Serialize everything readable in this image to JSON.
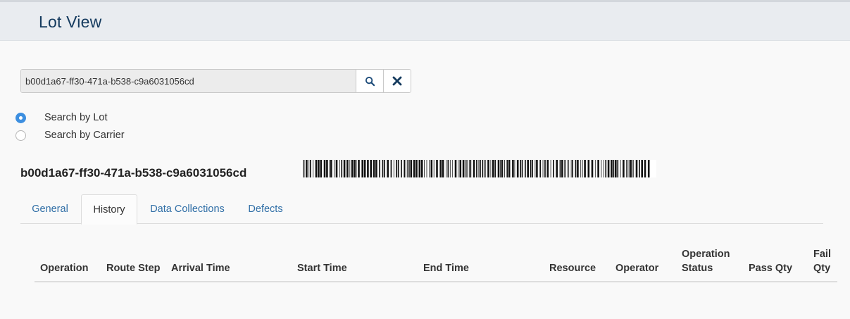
{
  "header": {
    "title": "Lot View"
  },
  "search": {
    "value": "b00d1a67-ff30-471a-b538-c9a6031056cd"
  },
  "search_mode": [
    {
      "label": "Search by Lot",
      "checked": true
    },
    {
      "label": "Search by Carrier",
      "checked": false
    }
  ],
  "lot": {
    "id": "b00d1a67-ff30-471a-b538-c9a6031056cd"
  },
  "tabs": [
    {
      "label": "General",
      "active": false
    },
    {
      "label": "History",
      "active": true
    },
    {
      "label": "Data Collections",
      "active": false
    },
    {
      "label": "Defects",
      "active": false
    }
  ],
  "history_table": {
    "columns": [
      "Operation",
      "Route Step",
      "Arrival Time",
      "Start Time",
      "End Time",
      "Resource",
      "Operator",
      "Operation Status",
      "Pass Qty",
      "Fail Qty"
    ],
    "rows": []
  },
  "colors": {
    "header_bg": "#e9ecf0",
    "title": "#143a5e",
    "link": "#2f6ea6",
    "radio_checked": "#3d8fe0"
  }
}
